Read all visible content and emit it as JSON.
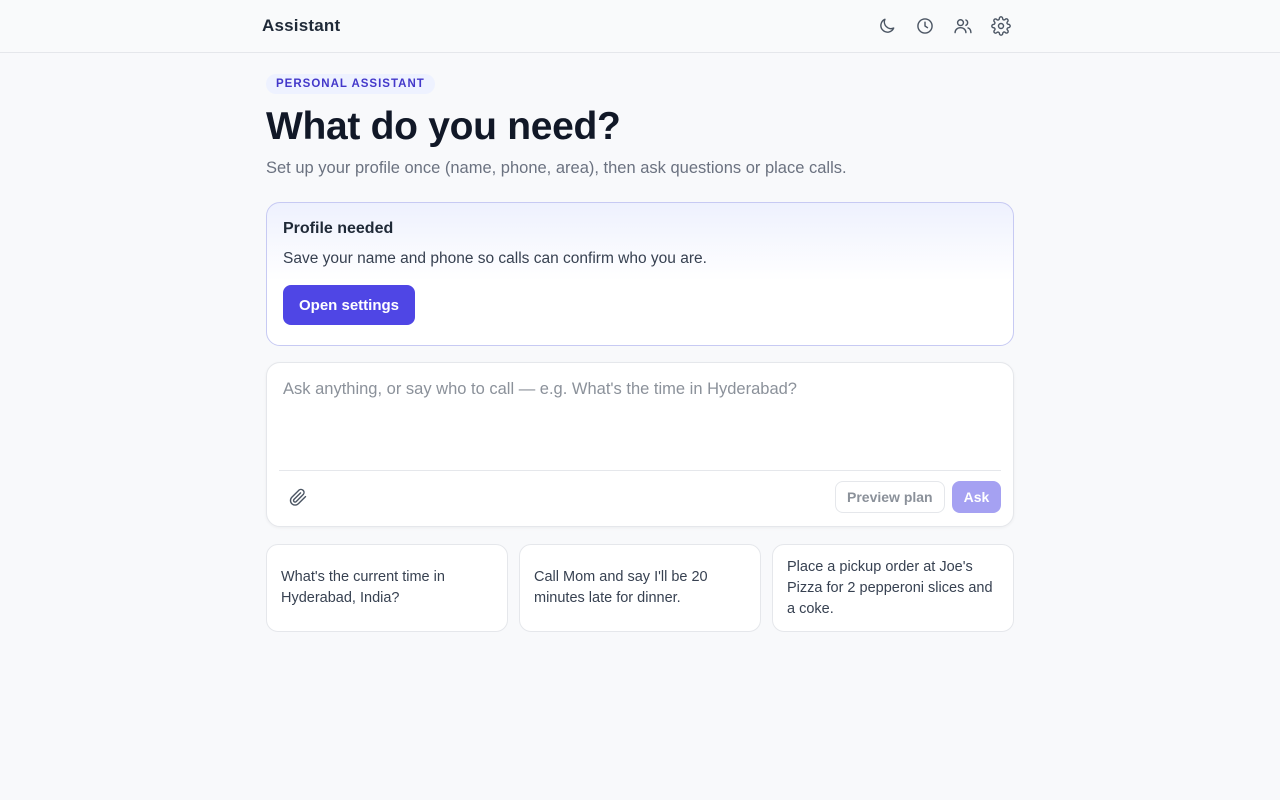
{
  "header": {
    "title": "Assistant",
    "icons": [
      {
        "name": "moon-icon",
        "label": "Theme"
      },
      {
        "name": "clock-icon",
        "label": "History"
      },
      {
        "name": "users-icon",
        "label": "Contacts"
      },
      {
        "name": "gear-icon",
        "label": "Settings"
      }
    ]
  },
  "hero": {
    "eyebrow": "PERSONAL ASSISTANT",
    "title": "What do you need?",
    "subtitle": "Set up your profile once (name, phone, area), then ask questions or place calls."
  },
  "profile_card": {
    "title": "Profile needed",
    "text": "Save your name and phone so calls can confirm who you are.",
    "button_label": "Open settings"
  },
  "composer": {
    "placeholder": "Ask anything, or say who to call — e.g. What's the time in Hyderabad?",
    "value": "",
    "preview_label": "Preview plan",
    "ask_label": "Ask"
  },
  "suggestions": [
    "What's the current time in Hyderabad, India?",
    "Call Mom and say I'll be 20 minutes late for dinner.",
    "Place a pickup order at Joe's Pizza for 2 pepperoni slices and a coke."
  ],
  "colors": {
    "accent": "#4f46e5",
    "accent_disabled": "#a5a1f2",
    "eyebrow_bg": "#eef2ff",
    "eyebrow_text": "#4338ca",
    "page_bg": "#f8f9fb"
  }
}
